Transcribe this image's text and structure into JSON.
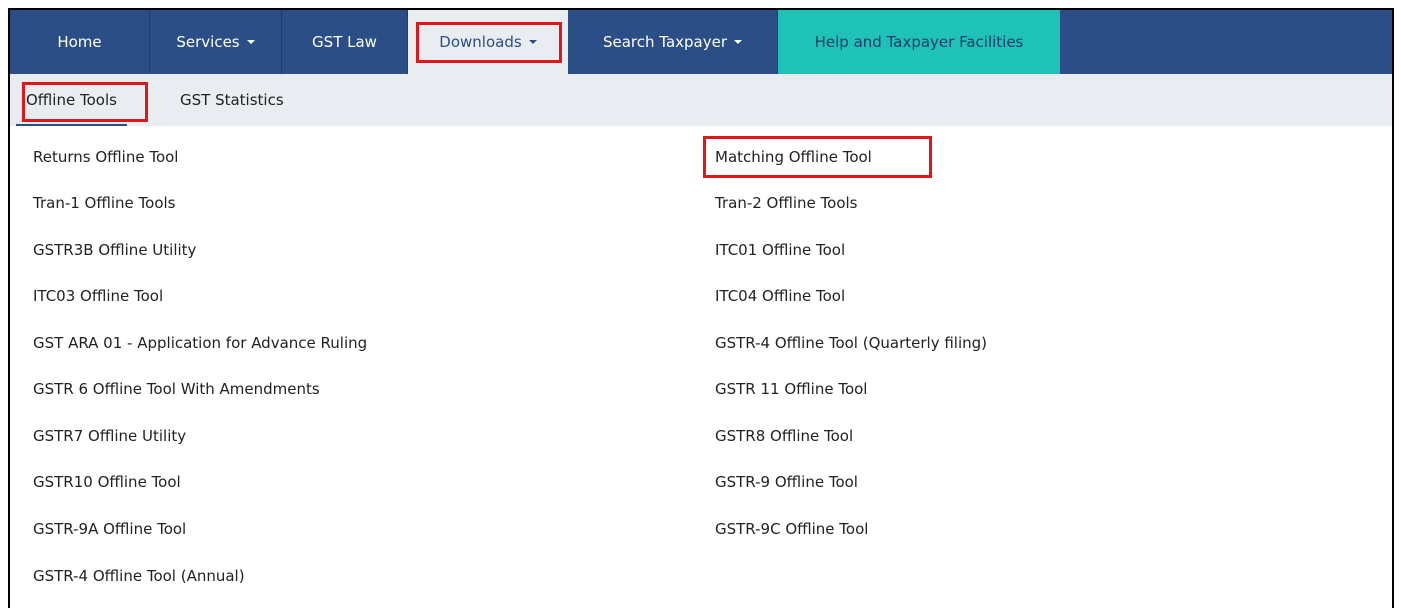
{
  "navbar": {
    "items": [
      {
        "label": "Home",
        "has_caret": false
      },
      {
        "label": "Services",
        "has_caret": true
      },
      {
        "label": "GST Law",
        "has_caret": false
      },
      {
        "label": "Downloads",
        "has_caret": true,
        "active": true
      },
      {
        "label": "Search Taxpayer",
        "has_caret": true
      },
      {
        "label": "Help and Taxpayer Facilities",
        "has_caret": false
      }
    ]
  },
  "subnav": {
    "tabs": [
      {
        "label": "Offline Tools",
        "active": true
      },
      {
        "label": "GST Statistics",
        "active": false
      }
    ]
  },
  "menu": {
    "left": [
      "Returns Offline Tool",
      "Tran-1 Offline Tools",
      "GSTR3B Offline Utility",
      "ITC03 Offline Tool",
      "GST ARA 01 - Application for Advance Ruling",
      "GSTR 6 Offline Tool With Amendments",
      "GSTR7 Offline Utility",
      "GSTR10 Offline Tool",
      "GSTR-9A Offline Tool",
      "GSTR-4 Offline Tool (Annual)"
    ],
    "right": [
      "Matching Offline Tool",
      "Tran-2 Offline Tools",
      "ITC01 Offline Tool",
      "ITC04 Offline Tool",
      "GSTR-4 Offline Tool (Quarterly filing)",
      "GSTR 11 Offline Tool",
      "GSTR8 Offline Tool",
      "GSTR-9 Offline Tool",
      "GSTR-9C Offline Tool"
    ]
  },
  "colors": {
    "navbar_bg": "#2c4e86",
    "active_tab_bg": "#e9edf2",
    "help_bg": "#1ec2b6",
    "highlight_red": "#e0161b"
  }
}
